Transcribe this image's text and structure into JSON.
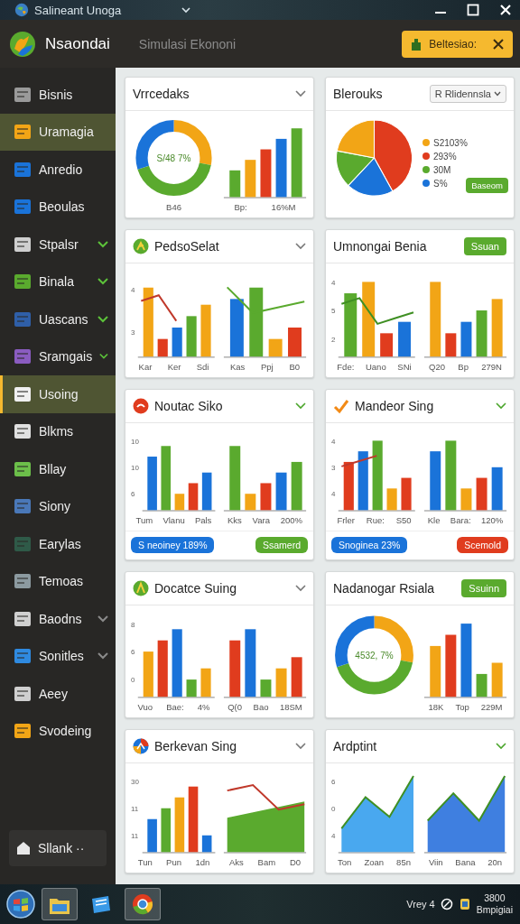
{
  "window": {
    "title": "Salineant Unoga"
  },
  "header": {
    "app_name": "Nsaondai",
    "subtitle": "Simulasi Ekononi",
    "notification": "Beltesiao:"
  },
  "sidebar": {
    "items": [
      {
        "label": "Bisnis",
        "selected": false
      },
      {
        "label": "Uramagia",
        "selected": true
      },
      {
        "label": "Anredio",
        "selected": false
      },
      {
        "label": "Beoulas",
        "selected": false
      },
      {
        "label": "Stpalsr",
        "selected": false,
        "checked": true
      },
      {
        "label": "Binala",
        "selected": false,
        "checked": true
      },
      {
        "label": "Uascans",
        "selected": false,
        "checked": true
      },
      {
        "label": "Sramgais",
        "selected": false,
        "checked": true
      },
      {
        "label": "Usoing",
        "selected": true,
        "focused": true
      },
      {
        "label": "Blkms",
        "selected": false
      },
      {
        "label": "Bllay",
        "selected": false
      },
      {
        "label": "Siony",
        "selected": false
      },
      {
        "label": "Earylas",
        "selected": false
      },
      {
        "label": "Temoas",
        "selected": false
      },
      {
        "label": "Baodns",
        "selected": false,
        "checked": false
      },
      {
        "label": "Sonitles",
        "selected": false,
        "checked": false
      },
      {
        "label": "Aeey",
        "selected": false
      },
      {
        "label": "Svodeing",
        "selected": false
      }
    ],
    "footer_button": "Sllank ··"
  },
  "cards": [
    {
      "title": "Vrrcedaks",
      "action": {
        "kind": "chevron",
        "active": false
      },
      "charts": [
        {
          "kind": "donut",
          "center": "S/48 7%",
          "labels": [
            "B46"
          ]
        },
        {
          "kind": "bar",
          "labels": [
            "Bp:",
            "16%M"
          ]
        }
      ]
    },
    {
      "title": "Blerouks",
      "action": {
        "kind": "dropdown",
        "value": "R Rlidennsla"
      },
      "charts": [
        {
          "kind": "pie"
        },
        {
          "kind": "legend",
          "items": [
            {
              "text": "S2103%",
              "color": "#f2a516"
            },
            {
              "text": "293%",
              "color": "#e03c1e"
            },
            {
              "text": "30M",
              "color": "#5aaa2e"
            },
            {
              "text": "S%",
              "color": "#1a73d9"
            }
          ],
          "button": "Baseom"
        }
      ]
    },
    {
      "title": "PedsoSelat",
      "icon": true,
      "action": {
        "kind": "chevron",
        "active": false
      },
      "charts": [
        {
          "kind": "bar_line",
          "ticks": [
            "4",
            "3"
          ],
          "labels": [
            "Kar",
            "Ker",
            "Sdi"
          ]
        },
        {
          "kind": "line",
          "labels": [
            "Kas",
            "Ppj",
            "B0"
          ]
        }
      ]
    },
    {
      "title": "Umnongai Benia",
      "action": {
        "kind": "button",
        "label": "Ssuan"
      },
      "charts": [
        {
          "kind": "area_bar",
          "ticks": [
            "4",
            "5",
            "2"
          ],
          "labels": [
            "Fde:",
            "Uano",
            "SNi"
          ]
        },
        {
          "kind": "bar",
          "labels": [
            "Q20",
            "Bp",
            "279N"
          ]
        }
      ]
    },
    {
      "title": "Noutac Siko",
      "icon": true,
      "action": {
        "kind": "chevron",
        "active": true
      },
      "charts": [
        {
          "kind": "bar",
          "ticks": [
            "10",
            "10",
            "6"
          ],
          "labels": [
            "Tum",
            "Vlanu",
            "Pals"
          ]
        },
        {
          "kind": "bar",
          "labels": [
            "Kks",
            "Vara",
            "200%"
          ]
        }
      ],
      "footer": [
        {
          "label": "S neoiney 189%",
          "color": "#1a73d9"
        },
        {
          "label": "Ssamerd",
          "color": "#5aaa2e"
        }
      ]
    },
    {
      "title": "Mandeor Sing",
      "icon": true,
      "action": {
        "kind": "chevron",
        "active": true
      },
      "charts": [
        {
          "kind": "bar_line",
          "ticks": [
            "4",
            "3",
            "4"
          ],
          "labels": [
            "Frler",
            "Rue:",
            "S50"
          ]
        },
        {
          "kind": "bar",
          "labels": [
            "Kle",
            "Bara:",
            "120%"
          ]
        }
      ],
      "footer": [
        {
          "label": "Snoginea 23%",
          "color": "#1a73d9"
        },
        {
          "label": "Scemold",
          "color": "#e03c1e"
        }
      ]
    },
    {
      "title": "Docatce Suing",
      "icon": true,
      "action": {
        "kind": "chevron",
        "active": false
      },
      "charts": [
        {
          "kind": "bar",
          "ticks": [
            "8",
            "6",
            "0"
          ],
          "labels": [
            "Vuo",
            "Bae:",
            "4%"
          ]
        },
        {
          "kind": "bar",
          "labels": [
            "Q(0",
            "Bao",
            "18SM"
          ]
        }
      ]
    },
    {
      "title": "Nadanogar Rsiala",
      "action": {
        "kind": "button",
        "label": "Ssuinn"
      },
      "charts": [
        {
          "kind": "donut",
          "center": "4532, 7%"
        },
        {
          "kind": "bar",
          "labels": [
            "18K",
            "Top",
            "229M"
          ]
        }
      ]
    },
    {
      "title": "Berkevan Sing",
      "icon": true,
      "action": {
        "kind": "chevron",
        "active": false
      },
      "charts": [
        {
          "kind": "bar",
          "ticks": [
            "30",
            "11",
            "11"
          ],
          "labels": [
            "Tun",
            "Pun",
            "1dn"
          ]
        },
        {
          "kind": "area_line",
          "labels": [
            "Aks",
            "Bam",
            "D0"
          ]
        }
      ]
    },
    {
      "title": "Ardptint",
      "action": {
        "kind": "chevron",
        "active": true
      },
      "charts": [
        {
          "kind": "area",
          "ticks": [
            "6",
            "0",
            "4"
          ],
          "labels": [
            "Ton",
            "Zoan",
            "85n"
          ]
        },
        {
          "kind": "area",
          "labels": [
            "Viin",
            "Bana",
            "20n"
          ]
        }
      ]
    }
  ],
  "taskbar": {
    "apps": [
      {
        "active": true
      },
      {
        "active": false
      },
      {
        "active": true
      }
    ],
    "tray_text": "Vrey 4",
    "clock": "3800",
    "date": "Bmpigiai"
  }
}
